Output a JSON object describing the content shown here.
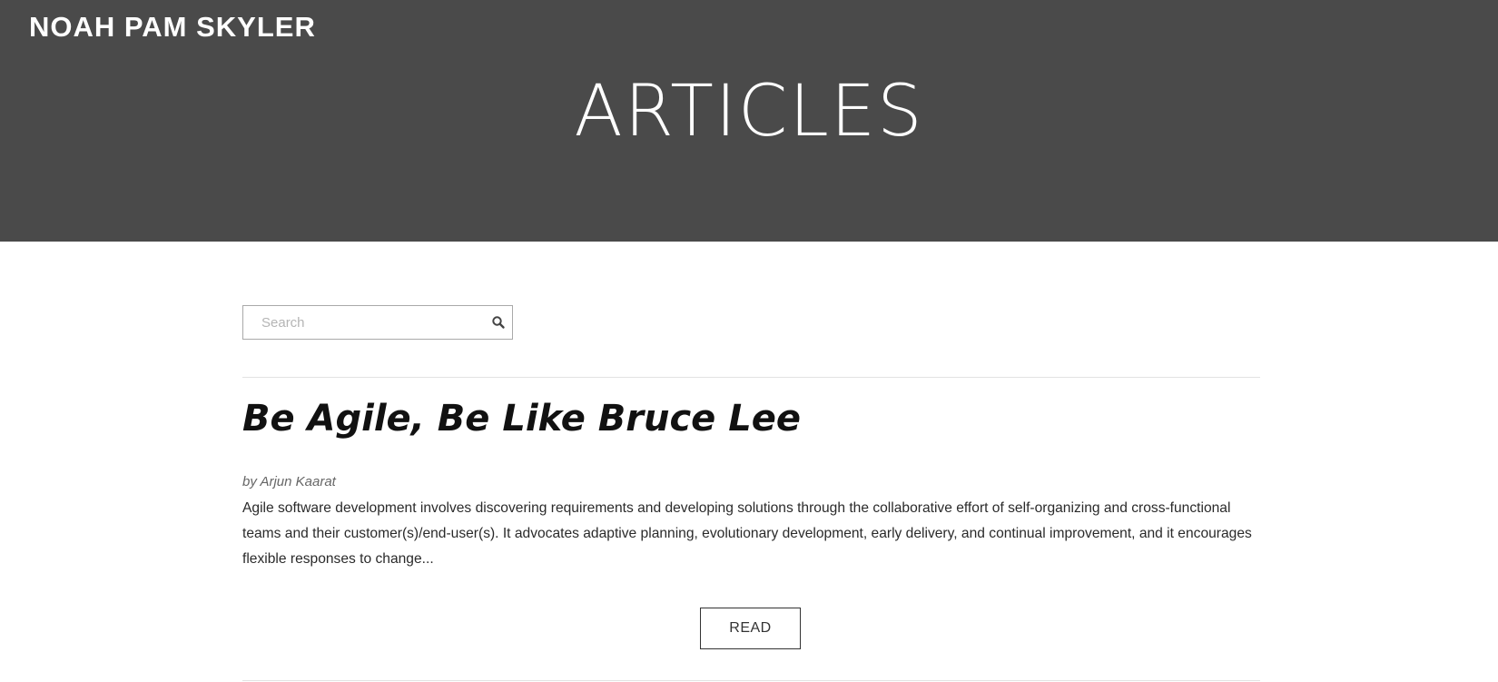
{
  "site": {
    "title": "NOAH PAM SKYLER"
  },
  "header": {
    "heading": "ARTICLES",
    "background_color": "#4a4a4a"
  },
  "search": {
    "placeholder": "Search",
    "value": "",
    "icon": "search-icon"
  },
  "article": {
    "title": "Be Agile, Be Like Bruce Lee",
    "byline": "by Arjun Kaarat",
    "excerpt": "Agile software development involves discovering requirements and developing solutions through the collaborative effort of self-organizing and cross-functional teams and their customer(s)/end-user(s). It advocates adaptive planning, evolutionary development, early delivery, and continual improvement, and it encourages flexible responses to change...",
    "read_label": "READ"
  }
}
